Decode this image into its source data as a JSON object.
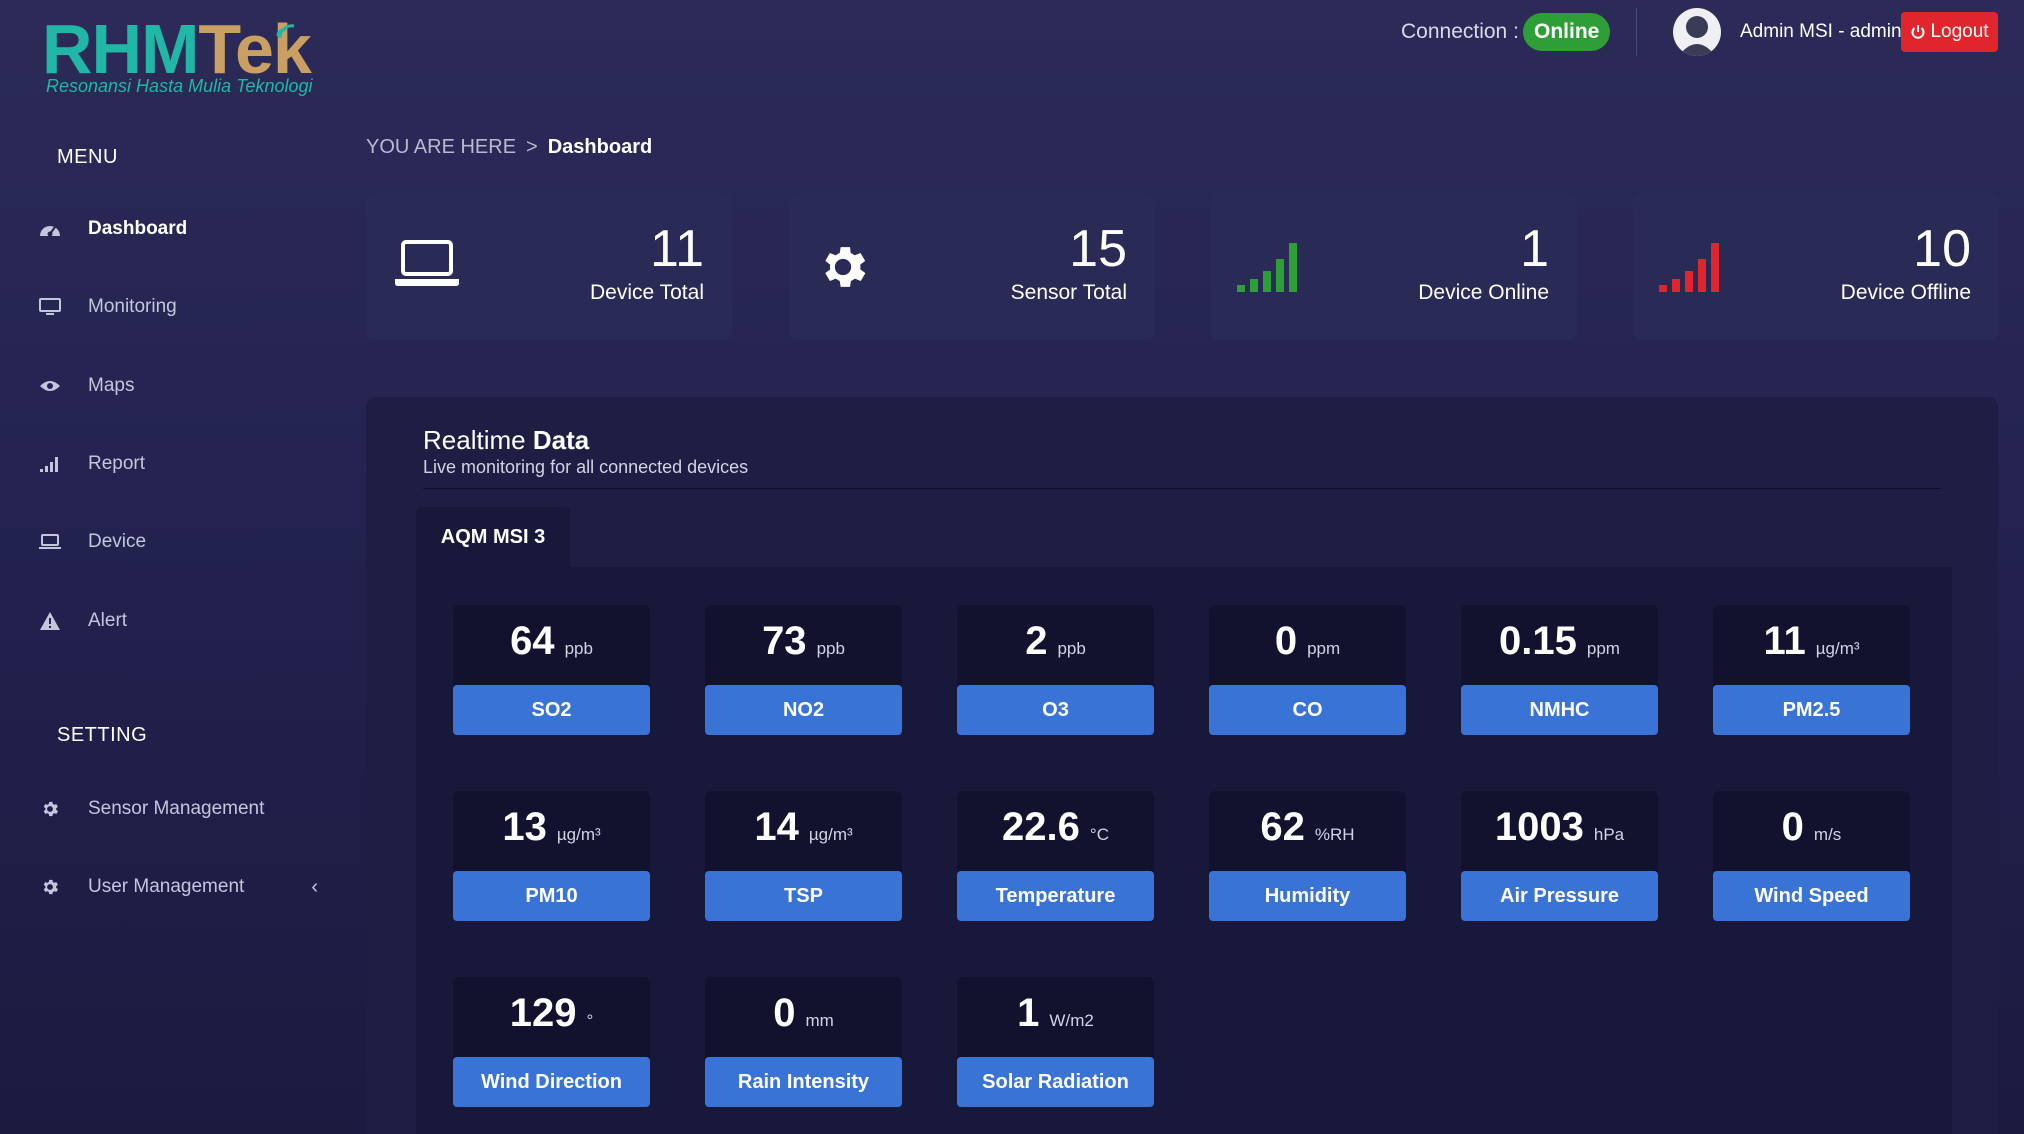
{
  "logo": {
    "part1": "RHM",
    "part2": "Tek",
    "tagline": "Resonansi Hasta Mulia Teknologi"
  },
  "sidebar": {
    "menu_heading": "MENU",
    "items": [
      {
        "label": "Dashboard",
        "icon": "dashboard-icon"
      },
      {
        "label": "Monitoring",
        "icon": "monitor-icon"
      },
      {
        "label": "Maps",
        "icon": "eye-icon"
      },
      {
        "label": "Report",
        "icon": "signal-bars-icon"
      },
      {
        "label": "Device",
        "icon": "laptop-icon"
      },
      {
        "label": "Alert",
        "icon": "warning-icon"
      }
    ],
    "setting_heading": "SETTING",
    "settings": [
      {
        "label": "Sensor Management",
        "icon": "gear-icon"
      },
      {
        "label": "User Management",
        "icon": "gear-icon"
      }
    ],
    "chevron": "‹"
  },
  "topbar": {
    "connection_label": "Connection :",
    "connection_status": "Online",
    "user": "Admin MSI - admin",
    "logout": "Logout"
  },
  "breadcrumb": {
    "prefix": "YOU ARE HERE",
    "separator": ">",
    "current": "Dashboard"
  },
  "stats": [
    {
      "value": "11",
      "label": "Device Total",
      "icon": "laptop-icon"
    },
    {
      "value": "15",
      "label": "Sensor Total",
      "icon": "gear-icon"
    },
    {
      "value": "1",
      "label": "Device Online",
      "icon": "signal-bars-icon",
      "color": "#2e9e36"
    },
    {
      "value": "10",
      "label": "Device Offline",
      "icon": "signal-bars-icon",
      "color": "#e0262c"
    }
  ],
  "realtime": {
    "title_light": "Realtime",
    "title_bold": "Data",
    "subtitle": "Live monitoring for all connected devices",
    "tab": "AQM MSI 3",
    "sensors": [
      {
        "value": "64",
        "unit": "ppb",
        "name": "SO2"
      },
      {
        "value": "73",
        "unit": "ppb",
        "name": "NO2"
      },
      {
        "value": "2",
        "unit": "ppb",
        "name": "O3"
      },
      {
        "value": "0",
        "unit": "ppm",
        "name": "CO"
      },
      {
        "value": "0.15",
        "unit": "ppm",
        "name": "NMHC"
      },
      {
        "value": "11",
        "unit": "µg/m³",
        "name": "PM2.5"
      },
      {
        "value": "13",
        "unit": "µg/m³",
        "name": "PM10"
      },
      {
        "value": "14",
        "unit": "µg/m³",
        "name": "TSP"
      },
      {
        "value": "22.6",
        "unit": "°C",
        "name": "Temperature"
      },
      {
        "value": "62",
        "unit": "%RH",
        "name": "Humidity"
      },
      {
        "value": "1003",
        "unit": "hPa",
        "name": "Air Pressure"
      },
      {
        "value": "0",
        "unit": "m/s",
        "name": "Wind Speed"
      },
      {
        "value": "129",
        "unit": "°",
        "name": "Wind Direction"
      },
      {
        "value": "0",
        "unit": "mm",
        "name": "Rain Intensity"
      },
      {
        "value": "1",
        "unit": "W/m2",
        "name": "Solar Radiation"
      }
    ]
  },
  "colors": {
    "accent": "#3a73d6",
    "online": "#2e9e36",
    "danger": "#e0262c",
    "logo_teal": "#21b7a6",
    "logo_gold": "#c9a061"
  }
}
